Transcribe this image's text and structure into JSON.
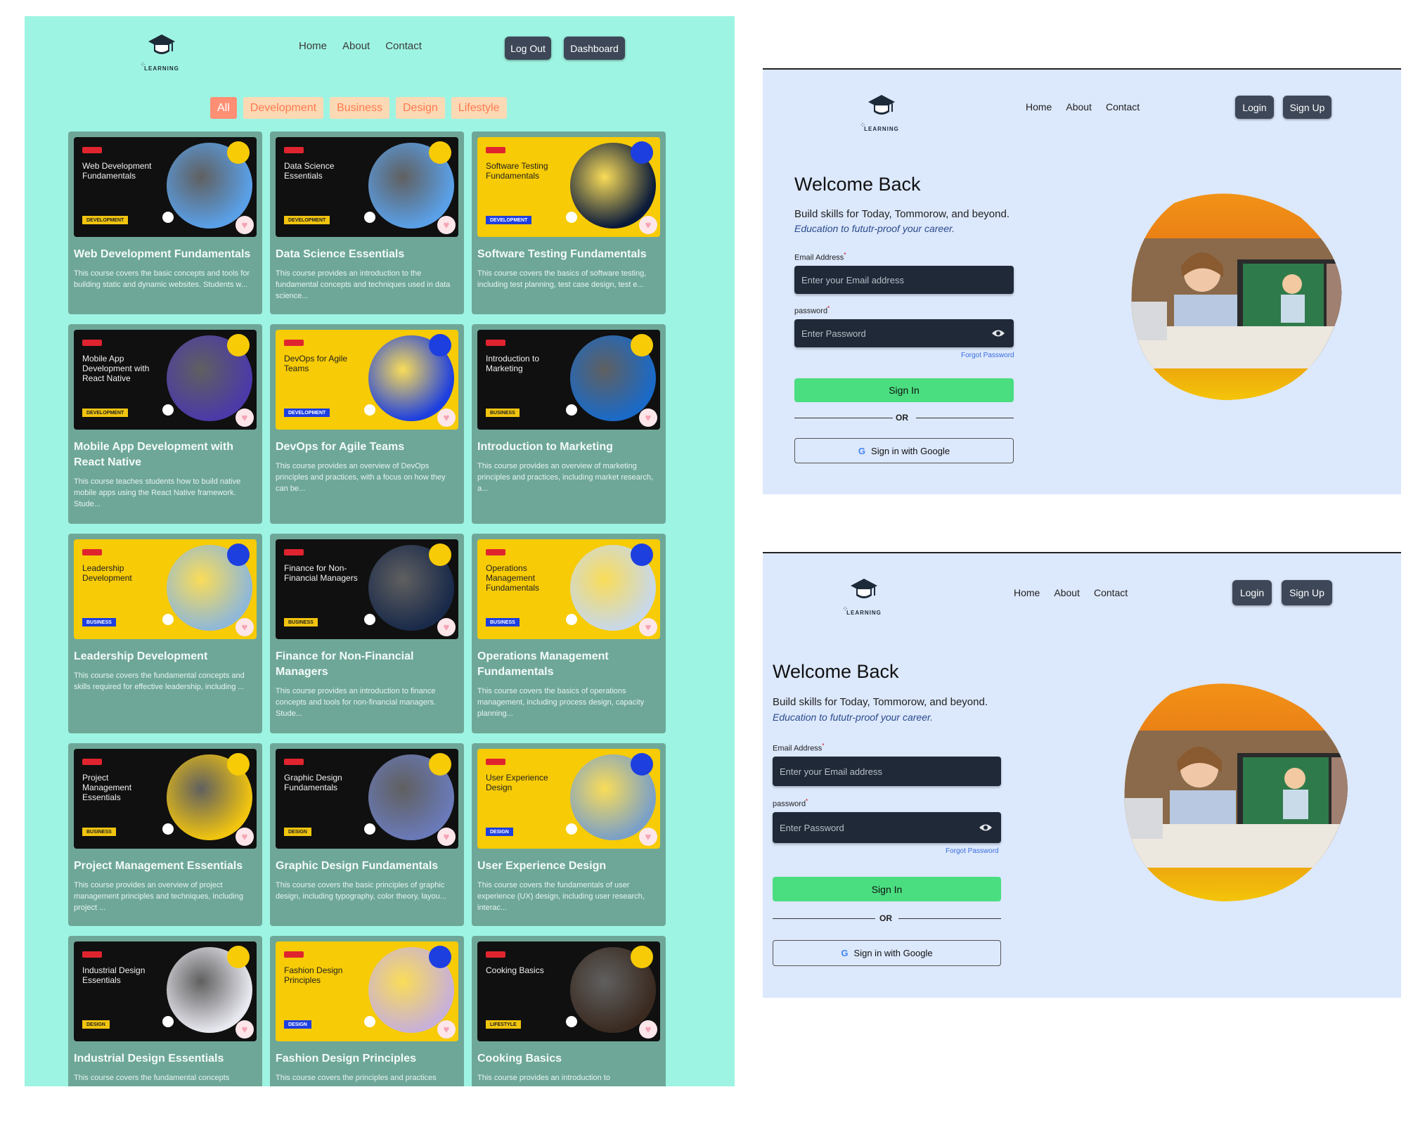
{
  "catalog": {
    "logo_text": "LEARNING",
    "nav": [
      "Home",
      "About",
      "Contact"
    ],
    "logout_label": "Log Out",
    "dashboard_label": "Dashboard",
    "filters": [
      "All",
      "Development",
      "Business",
      "Design",
      "Lifestyle"
    ],
    "active_filter": "All",
    "courses": [
      {
        "thumb_title": "Web Development Fundamentals",
        "tag": "DEVELOPMENT",
        "theme": "dark",
        "title": "Web Development Fundamentals",
        "desc": "This course covers the basic concepts and tools for building static and dynamic websites. Students w..."
      },
      {
        "thumb_title": "Data Science Essentials",
        "tag": "DEVELOPMENT",
        "theme": "dark",
        "title": "Data Science Essentials",
        "desc": "This course provides an introduction to the fundamental concepts and techniques used in data science..."
      },
      {
        "thumb_title": "Software Testing Fundamentals",
        "tag": "DEVELOPMENT",
        "theme": "yellow",
        "title": "Software Testing Fundamentals",
        "desc": "This course covers the basics of software testing, including test planning, test case design, test e..."
      },
      {
        "thumb_title": "Mobile App Development with React Native",
        "tag": "DEVELOPMENT",
        "theme": "dark",
        "title": "Mobile App Development with React Native",
        "desc": "This course teaches students how to build native mobile apps using the React Native framework. Stude..."
      },
      {
        "thumb_title": "DevOps for Agile Teams",
        "tag": "DEVELOPMENT",
        "theme": "yellow",
        "title": "DevOps for Agile Teams",
        "desc": "This course provides an overview of DevOps principles and practices, with a focus on how they can be..."
      },
      {
        "thumb_title": "Introduction to Marketing",
        "tag": "BUSINESS",
        "theme": "dark",
        "title": "Introduction to Marketing",
        "desc": "This course provides an overview of marketing principles and practices, including market research, a..."
      },
      {
        "thumb_title": "Leadership Development",
        "tag": "BUSINESS",
        "theme": "yellow",
        "title": "Leadership Development",
        "desc": "This course covers the fundamental concepts and skills required for effective leadership, including ..."
      },
      {
        "thumb_title": "Finance for Non-Financial Managers",
        "tag": "BUSINESS",
        "theme": "dark",
        "title": "Finance for Non-Financial Managers",
        "desc": "This course provides an introduction to finance concepts and tools for non-financial managers. Stude..."
      },
      {
        "thumb_title": "Operations Management Fundamentals",
        "tag": "BUSINESS",
        "theme": "yellow",
        "title": "Operations Management Fundamentals",
        "desc": "This course covers the basics of operations management, including process design, capacity planning..."
      },
      {
        "thumb_title": "Project Management Essentials",
        "tag": "BUSINESS",
        "theme": "dark",
        "title": "Project Management Essentials",
        "desc": "This course provides an overview of project management principles and techniques, including project ..."
      },
      {
        "thumb_title": "Graphic Design Fundamentals",
        "tag": "DESIGN",
        "theme": "dark",
        "title": "Graphic Design Fundamentals",
        "desc": "This course covers the basic principles of graphic design, including typography, color theory, layou..."
      },
      {
        "thumb_title": "User Experience Design",
        "tag": "DESIGN",
        "theme": "yellow",
        "title": "User Experience Design",
        "desc": "This course covers the fundamentals of user experience (UX) design, including user research, interac..."
      },
      {
        "thumb_title": "Industrial Design Essentials",
        "tag": "DESIGN",
        "theme": "dark",
        "title": "Industrial Design Essentials",
        "desc": "This course covers the fundamental concepts"
      },
      {
        "thumb_title": "Fashion Design Principles",
        "tag": "DESIGN",
        "theme": "yellow",
        "title": "Fashion Design Principles",
        "desc": "This course covers the principles and practices"
      },
      {
        "thumb_title": "Cooking Basics",
        "tag": "LIFESTYLE",
        "theme": "dark",
        "title": "Cooking Basics",
        "desc": "This course provides an introduction to"
      }
    ]
  },
  "login": {
    "logo_text": "LEARNING",
    "nav": [
      "Home",
      "About",
      "Contact"
    ],
    "login_label": "Login",
    "signup_label": "Sign Up",
    "heading": "Welcome Back",
    "tagline": "Build skills for Today, Tommorow, and beyond.",
    "tagline_italic": "Education to fututr-proof your career.",
    "email_label": "Email Address",
    "email_placeholder": "Enter your Email address",
    "password_label": "password",
    "password_placeholder": "Enter Password",
    "forgot_label": "Forgot Password",
    "signin_label": "Sign In",
    "or_label": "OR",
    "google_label": "Sign in with Google"
  },
  "colors": {
    "catalog_bg": "#9ef4e2",
    "card_bg": "#6ea798",
    "login_bg": "#dce8fc",
    "signin_green": "#4ade80",
    "input_dark": "#1f2937"
  }
}
